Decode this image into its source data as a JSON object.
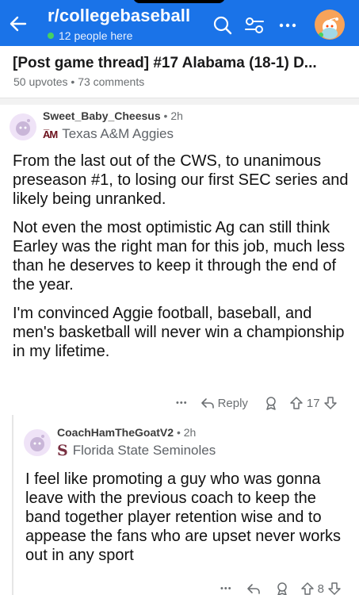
{
  "header": {
    "subreddit": "r/collegebaseball",
    "online": "12 people here",
    "icons": [
      "back-arrow-icon",
      "search-icon",
      "filter-icon",
      "more-icon",
      "avatar"
    ],
    "colors": {
      "bar": "#1a73e8",
      "online_dot": "#46d160"
    }
  },
  "post": {
    "title": "[Post game thread] #17 Alabama (18-1) D...",
    "upvotes": "50 upvotes",
    "comments": "73 comments"
  },
  "comments": [
    {
      "user": "Sweet_Baby_Cheesus",
      "time": "2h",
      "flair": "Texas A&M Aggies",
      "flair_logo": "A̅M",
      "paragraphs": [
        "From the last out of the CWS, to unanimous preseason #1, to losing our first SEC series and likely being unranked.",
        "Not even the most optimistic Ag can still think Earley was the right man for this job, much less than he deserves to keep it through the end of the year.",
        "I'm convinced Aggie football, baseball, and men's basketball will never win a championship in my lifetime."
      ],
      "actions": {
        "more": "•••",
        "reply": "Reply",
        "votes": "17"
      }
    },
    {
      "user": "CoachHamTheGoatV2",
      "time": "2h",
      "flair": "Florida State Seminoles",
      "flair_logo": "S",
      "paragraphs": [
        "I feel like promoting a guy who was gonna leave with the previous coach to keep the band together player retention wise and to appease the fans who are upset never works out in any sport"
      ],
      "actions": {
        "more": "•••",
        "votes": "8"
      }
    }
  ]
}
